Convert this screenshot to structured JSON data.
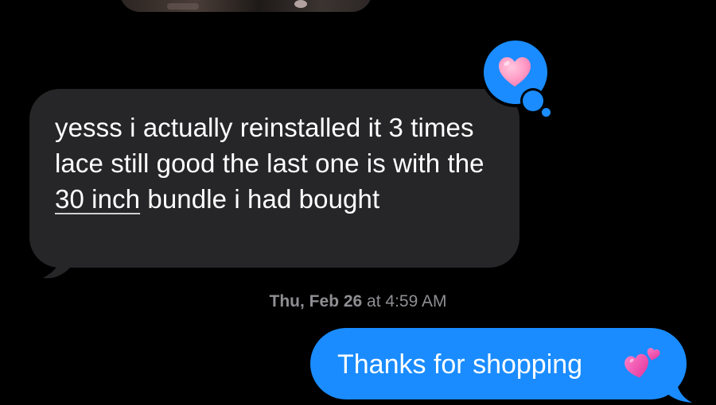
{
  "messages": [
    {
      "direction": "incoming",
      "text_before_link": "yesss i actually reinstalled it 3 times lace still good the last one is with the ",
      "link_text": "30 inch",
      "text_after_link": " bundle i had bought",
      "tapback": "heart-icon"
    },
    {
      "direction": "outgoing",
      "text": "Thanks for shopping",
      "emoji": "two-hearts-icon"
    }
  ],
  "timestamp": {
    "day": "Thu, Feb 26",
    "at": " at ",
    "time": "4:59 AM"
  },
  "colors": {
    "background": "#000000",
    "incoming_bubble": "#262628",
    "outgoing_bubble": "#1a8cff",
    "timestamp_text": "#8e8e93",
    "heart": "#ff8fbf"
  }
}
